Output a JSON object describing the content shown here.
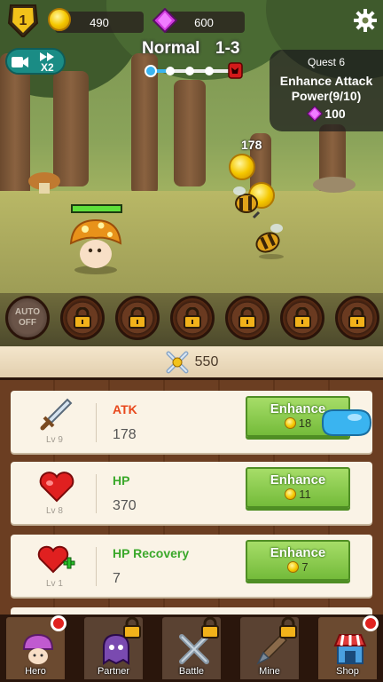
{
  "hud": {
    "level": "1",
    "coins": "490",
    "gems": "600",
    "speed_label": "X2",
    "stage_difficulty": "Normal",
    "stage_number": "1-3",
    "stage_progress_fraction": 0.5
  },
  "quest": {
    "title": "Quest 6",
    "description_line1": "Enhance Attack",
    "description_line2": "Power(9/10)",
    "reward": "100"
  },
  "battle": {
    "coin_drop_amount": "178",
    "hero_hp_fraction": 1.0
  },
  "skills": {
    "auto_line1": "AUTO",
    "auto_line2": "OFF",
    "locked_slots": 6
  },
  "combat_power": "550",
  "upgrades": [
    {
      "name": "ATK",
      "level": "Lv 9",
      "value": "178",
      "button": "Enhance",
      "cost": "18",
      "name_color": "#e8481c"
    },
    {
      "name": "HP",
      "level": "Lv 8",
      "value": "370",
      "button": "Enhance",
      "cost": "11",
      "name_color": "#3aa82a"
    },
    {
      "name": "HP Recovery",
      "level": "Lv 1",
      "value": "7",
      "button": "Enhance",
      "cost": "7",
      "name_color": "#3aa82a"
    }
  ],
  "nav": [
    {
      "label": "Hero",
      "icon": "mushroom-hero-icon",
      "locked": false,
      "alert": true
    },
    {
      "label": "Partner",
      "icon": "partner-ghost-icon",
      "locked": true,
      "alert": false
    },
    {
      "label": "Battle",
      "icon": "crossed-swords-icon",
      "locked": true,
      "alert": false
    },
    {
      "label": "Mine",
      "icon": "shovel-icon",
      "locked": true,
      "alert": false
    },
    {
      "label": "Shop",
      "icon": "shop-stall-icon",
      "locked": false,
      "alert": true
    }
  ],
  "colors": {
    "gem": "#d23be0",
    "coin": "#f5c800",
    "enhance_green": "#7fc24a",
    "quest_bg": "#1e1e1e"
  }
}
